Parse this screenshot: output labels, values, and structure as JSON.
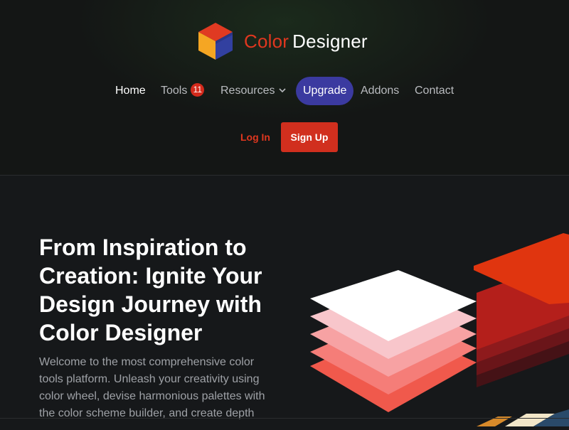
{
  "brand": {
    "word1": "Color",
    "word2": "Designer"
  },
  "nav": {
    "home": "Home",
    "tools": "Tools",
    "tools_badge": "11",
    "resources": "Resources",
    "upgrade": "Upgrade",
    "addons": "Addons",
    "contact": "Contact"
  },
  "auth": {
    "login": "Log In",
    "signup": "Sign Up"
  },
  "hero": {
    "title": "From Inspiration to Creation: Ignite Your Design Journey with Color Designer",
    "text": "Welcome to the most comprehensive color tools platform. Unleash your creativity using color wheel, devise harmonious palettes with the color scheme builder, and create depth"
  },
  "icons": {
    "logo": "cube-logo-icon",
    "resources_dropdown": "chevron-down-icon"
  },
  "colors": {
    "accent_red": "#e0371f",
    "signup_bg": "#d12f1e",
    "upgrade_bg": "#3b3aa0",
    "badge_bg": "#d42a1c",
    "cube_top": "#e03a22",
    "cube_left": "#f5a623",
    "cube_right": "#3240a0"
  }
}
